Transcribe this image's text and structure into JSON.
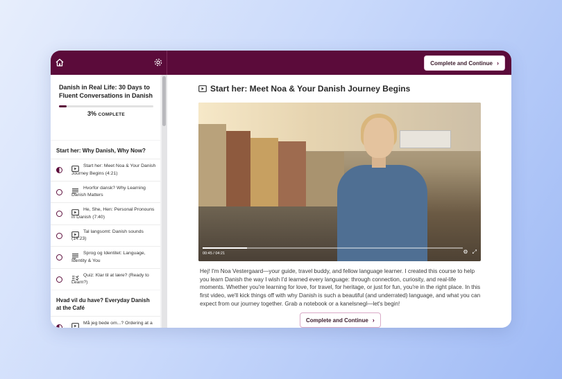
{
  "topbar": {
    "complete_label": "Complete and Continue"
  },
  "course": {
    "title": "Danish in Real Life: 30 Days to Fluent Conversations in Danish",
    "progress_percent": 3,
    "progress_value": "3%",
    "progress_label": "COMPLETE"
  },
  "sidebar": {
    "sections": [
      {
        "title": "Start her: Why Danish, Why Now?",
        "lessons": [
          {
            "icon": "video-icon",
            "state": "in-progress",
            "label": "Start her: Meet Noa & Your Danish Journey Begins (4:21)"
          },
          {
            "icon": "text-icon",
            "state": "not-started",
            "label": "Hvorfor dansk? Why Learning Danish Matters"
          },
          {
            "icon": "video-icon",
            "state": "not-started",
            "label": "He, She, Hen: Personal Pronouns in Danish (7:40)"
          },
          {
            "icon": "video-icon",
            "state": "not-started",
            "label": "Tal langsomt: Danish sounds (14:23)"
          },
          {
            "icon": "text-icon",
            "state": "not-started",
            "label": "Sprog og Identitet: Language, Identity & You"
          },
          {
            "icon": "quiz-icon",
            "state": "not-started",
            "label": "Quiz: Klar til at lære? (Ready to Learn?)"
          }
        ]
      },
      {
        "title": "Hvad vil du have? Everyday Danish at the Café",
        "lessons": [
          {
            "icon": "video-icon",
            "state": "in-progress",
            "label": "Må jeg bede om...? Ordering at a Danish Market"
          }
        ]
      }
    ]
  },
  "main": {
    "lesson_title": "Start her: Meet Noa & Your Danish Journey Begins",
    "video": {
      "time": "00:45 / 04:21",
      "progress_fraction": 0.17
    },
    "description": "Hej! I'm Noa Vestergaard—your guide, travel buddy, and fellow language learner. I created this course to help you learn Danish the way I wish I'd learned every language: through connection, curiosity, and real-life moments. Whether you're learning for love, for travel, for heritage, or just for fun, you're in the right place. In this first video, we'll kick things off with why Danish is such a beautiful (and underrated) language, and what you can expect from our journey together. Grab a notebook or a kanelsnegl—let's begin!",
    "complete_label": "Complete and Continue"
  },
  "colors": {
    "brand": "#5b0b3a",
    "page_bg_start": "#e7eefc",
    "page_bg_end": "#9fbaf5"
  }
}
